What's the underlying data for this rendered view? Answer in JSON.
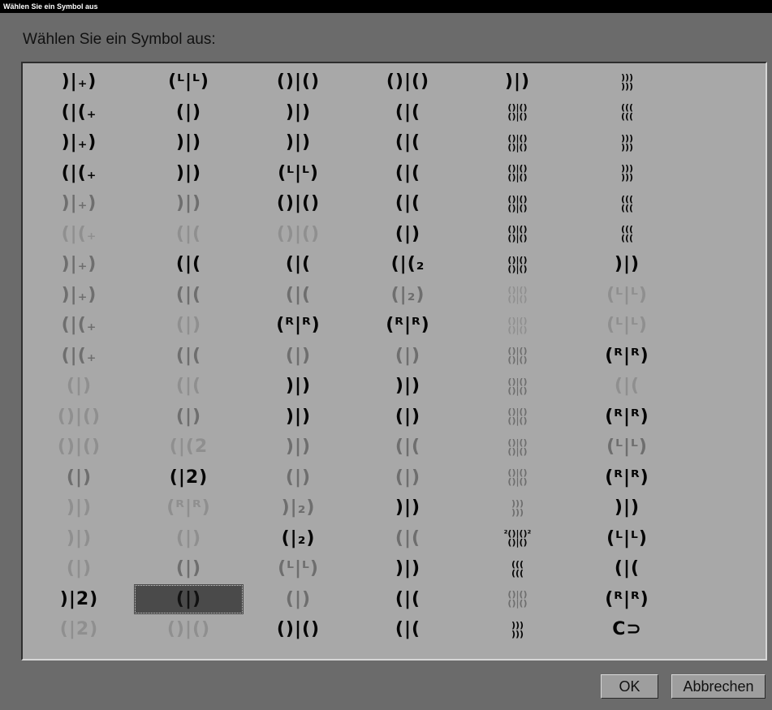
{
  "window": {
    "title": "Wählen Sie ein Symbol aus"
  },
  "dialog": {
    "heading": "Wählen Sie ein Symbol aus:"
  },
  "buttons": {
    "ok": "OK",
    "cancel": "Abbrechen"
  },
  "colors": {
    "background": "#6b6b6b",
    "panel": "#a8a8a8",
    "selection": "#4a4a4a"
  },
  "selected_index": 103,
  "symbols": [
    ")|₊)",
    "(ᴸ|ᴸ)",
    "()|()",
    "()|()",
    ")|)",
    ")))\n)))",
    "(|(₊",
    "(|)",
    ")|)",
    "(|(",
    "()|()\n()|()",
    "(((\n(((",
    ")|₊)",
    ")|)",
    ")|)",
    "(|(",
    "()|()\n()|()",
    ")))\n)))",
    "(|(₊",
    ")|)",
    "(ᴸ|ᴸ)",
    "(|(",
    "()|()\n()|()",
    ")))\n)))",
    ")|₊)",
    ")|)",
    "()|()",
    "(|(",
    "()|()\n()|()",
    "(((\n(((",
    "(|(₊",
    "(|(",
    "()|()",
    "(|)",
    "()|()\n()|()",
    "(((\n(((",
    ")|₊)",
    "(|(",
    "(|(",
    "(|(₂",
    "()|()\n()|()",
    ")|)",
    ")|₊)",
    "(|(",
    "(|(",
    "(|₂)",
    "()|()\n()|()",
    "(ᴸ|ᴸ)",
    "(|(₊",
    "(|)",
    "(ᴿ|ᴿ)",
    "(ᴿ|ᴿ)",
    "()|()\n()|()",
    "(ᴸ|ᴸ)",
    "(|(₊",
    "(|(",
    "(|)",
    "(|)",
    "()|()\n()|()",
    "(ᴿ|ᴿ)",
    "(|)",
    "(|(",
    ")|)",
    ")|)",
    "()|()\n()|()",
    "(|(",
    "()|()",
    "(|)",
    ")|)",
    "(|)",
    "()|()\n()|()",
    "(ᴿ|ᴿ)",
    "()|()",
    "(|(2",
    ")|)",
    "(|(",
    "()|()\n()|()",
    "(ᴸ|ᴸ)",
    "(|)",
    "(|2)",
    "(|)",
    "(|)",
    "()|()\n()|()",
    "(ᴿ|ᴿ)",
    ")|)",
    "(ᴿ|ᴿ)",
    ")|₂)",
    ")|)",
    ")))\n)))",
    ")|)",
    ")|)",
    "(|)",
    "(|₂)",
    "(|(",
    "²()|()²\n()|()",
    "(ᴸ|ᴸ)",
    "(|)",
    "(|)",
    "(ᴸ|ᴸ)",
    ")|)",
    "(((\n(((",
    "(|(",
    ")|2)",
    "(|)",
    "(|)",
    "(|(",
    "()|()\n()|()",
    "(ᴿ|ᴿ)",
    "(|2)",
    "()|()",
    "()|()",
    "(|(",
    ")))\n)))",
    "C⊃"
  ]
}
